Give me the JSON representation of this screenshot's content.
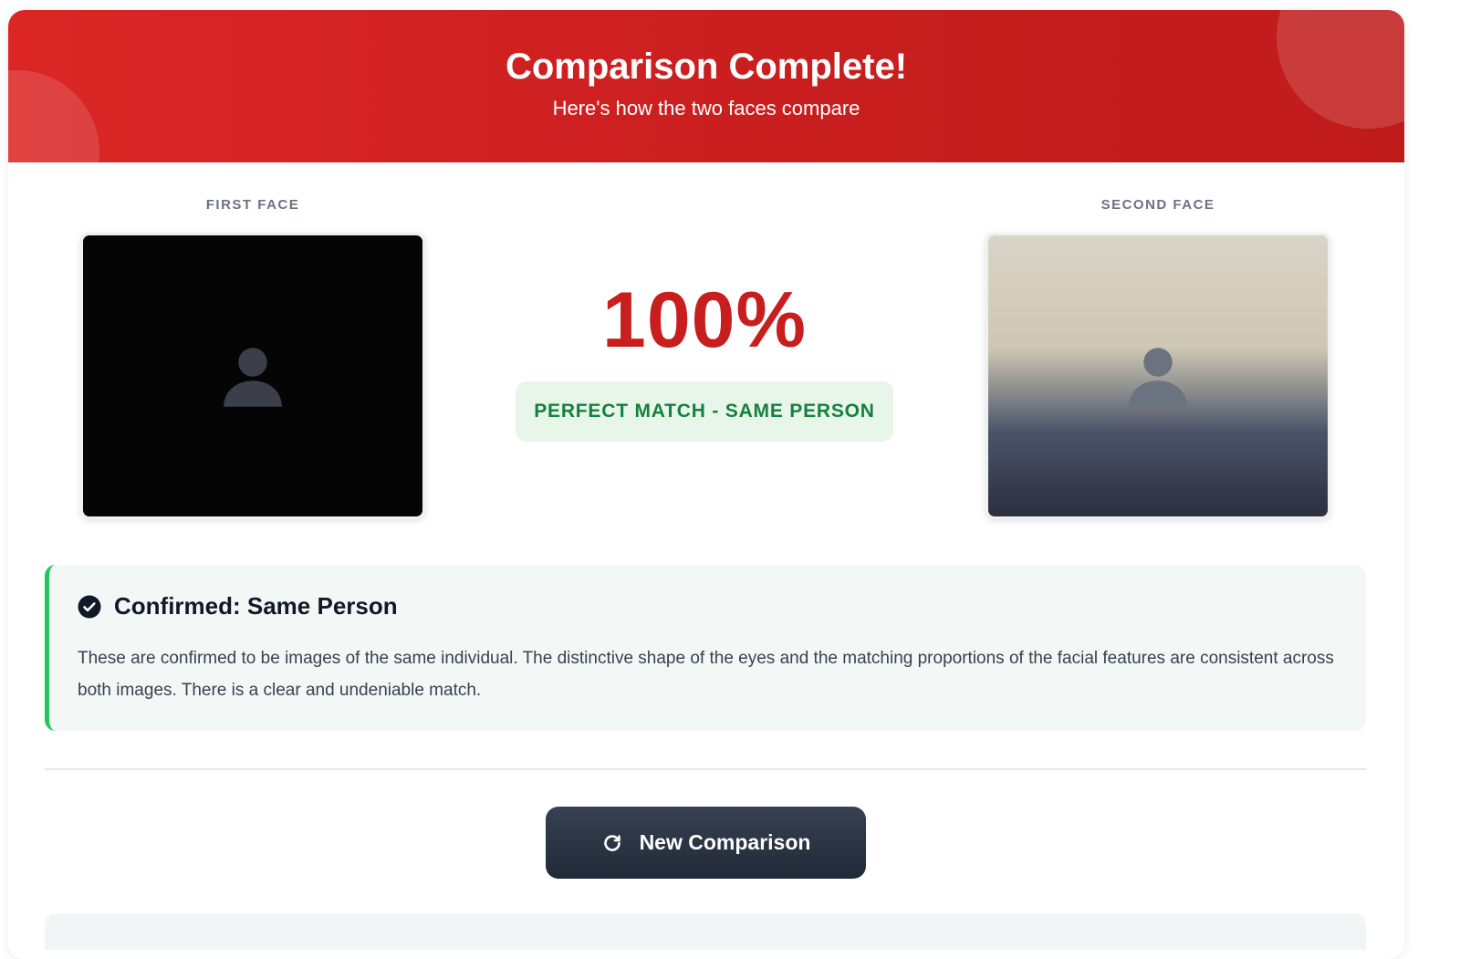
{
  "header": {
    "title": "Comparison Complete!",
    "subtitle": "Here's how the two faces compare"
  },
  "faces": {
    "first_label": "FIRST FACE",
    "second_label": "SECOND FACE"
  },
  "score": {
    "value": "100%",
    "verdict": "PERFECT MATCH - SAME PERSON"
  },
  "result": {
    "icon": "check-circle-icon",
    "title": "Confirmed: Same Person",
    "body": "These are confirmed to be images of the same individual. The distinctive shape of the eyes and the matching proportions of the facial features are consistent across both images. There is a clear and undeniable match."
  },
  "actions": {
    "new_comparison_label": "New Comparison",
    "new_comparison_icon": "refresh-icon"
  },
  "colors": {
    "accent": "#dc2626",
    "score": "#c81e1e",
    "success": "#22c55e",
    "verdict_text": "#15803d",
    "button": "#1f2937"
  }
}
